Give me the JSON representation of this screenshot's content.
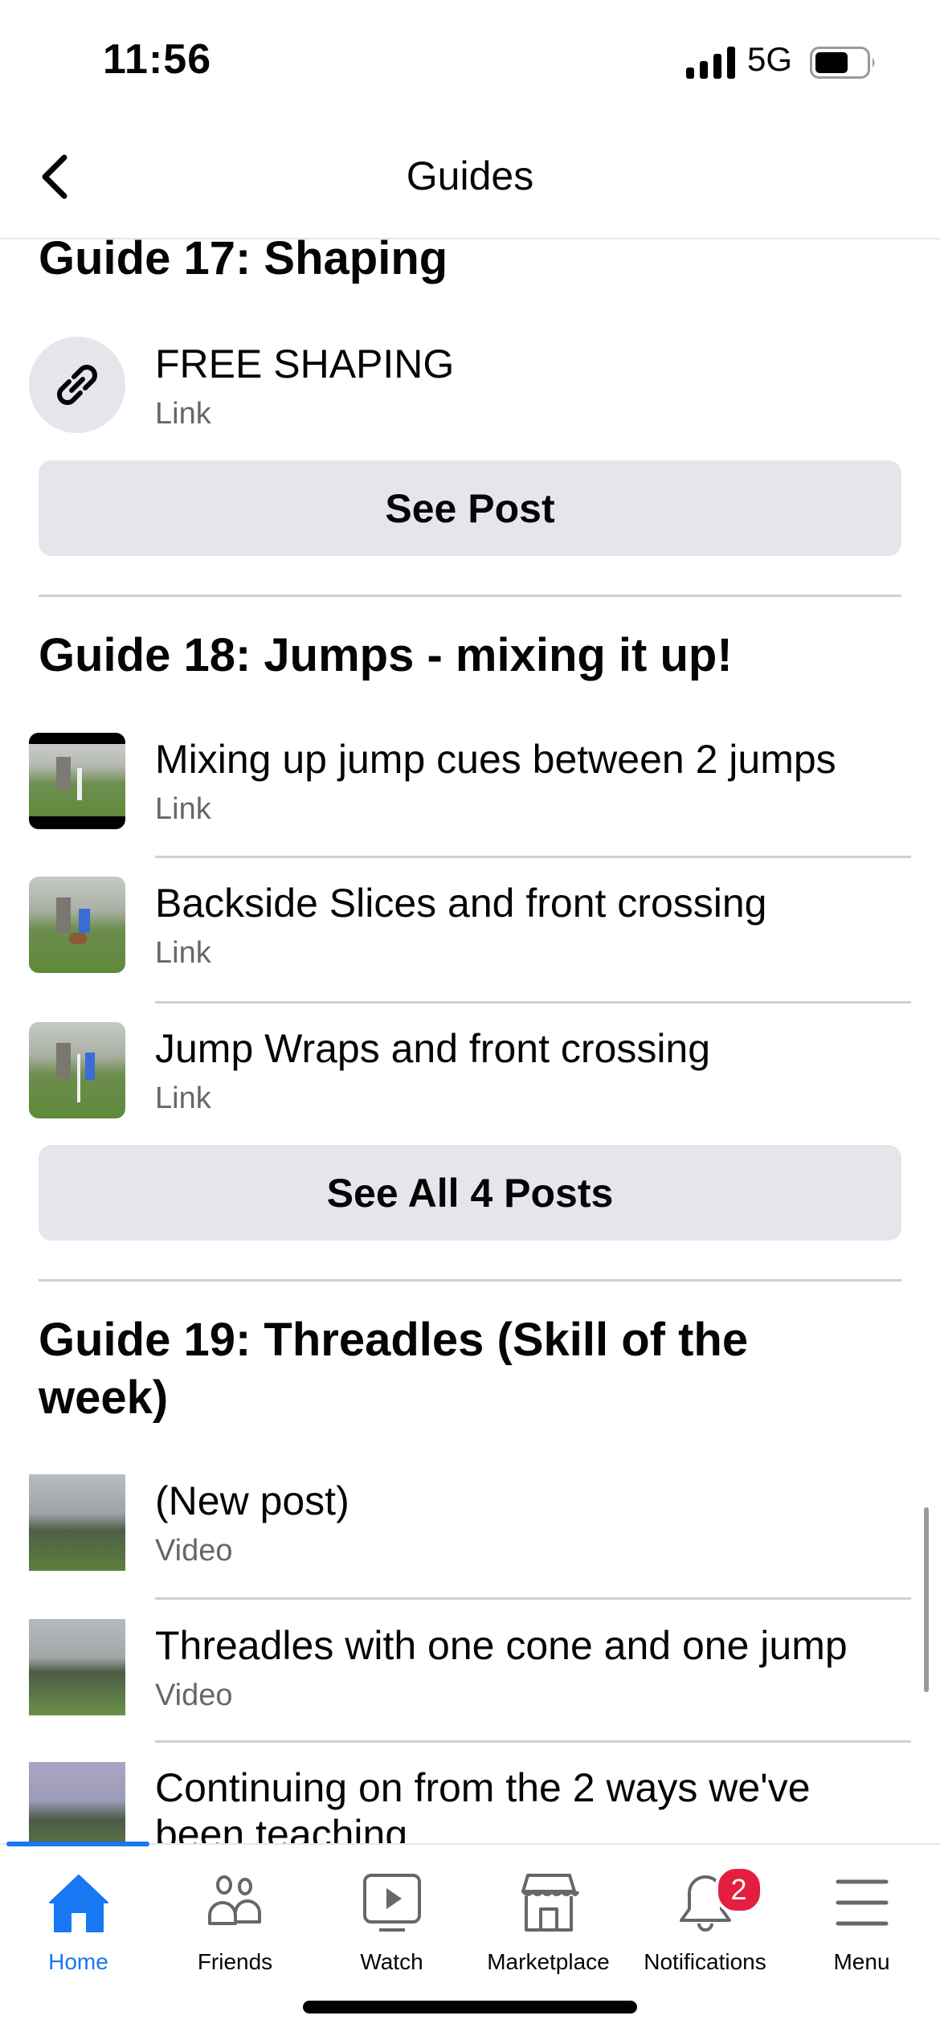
{
  "status_bar": {
    "time": "11:56",
    "network": "5G",
    "battery_level": 0.65
  },
  "header": {
    "title": "Guides",
    "back_icon": "chevron-left-icon"
  },
  "guides": [
    {
      "title": "Guide 17: Shaping",
      "items": [
        {
          "title": "FREE SHAPING",
          "type": "Link",
          "icon": "link-icon"
        }
      ],
      "button": "See Post"
    },
    {
      "title": "Guide 18: Jumps - mixing it up!",
      "items": [
        {
          "title": "Mixing up jump cues between 2 jumps",
          "type": "Link"
        },
        {
          "title": "Backside Slices and front crossing",
          "type": "Link"
        },
        {
          "title": "Jump Wraps and front crossing",
          "type": "Link"
        }
      ],
      "button": "See All 4 Posts"
    },
    {
      "title_line1": "Guide 19: Threadles (Skill of the",
      "title_line2": "week)",
      "items": [
        {
          "title": "(New post)",
          "type": "Video"
        },
        {
          "title": "Threadles with one cone and one jump",
          "type": "Video"
        },
        {
          "title_line1": "Continuing on from the 2 ways we've",
          "title_line2": "been teaching"
        }
      ]
    }
  ],
  "tab_bar": {
    "active": "Home",
    "tabs": [
      {
        "label": "Home",
        "icon": "home-icon"
      },
      {
        "label": "Friends",
        "icon": "friends-icon"
      },
      {
        "label": "Watch",
        "icon": "watch-icon"
      },
      {
        "label": "Marketplace",
        "icon": "marketplace-icon"
      },
      {
        "label": "Notifications",
        "icon": "bell-icon",
        "badge": "2"
      },
      {
        "label": "Menu",
        "icon": "menu-icon"
      }
    ]
  },
  "colors": {
    "accent": "#1877f2",
    "badge": "#e41e3f",
    "button_bg": "#e4e6eb",
    "secondary_text": "#65676b"
  }
}
